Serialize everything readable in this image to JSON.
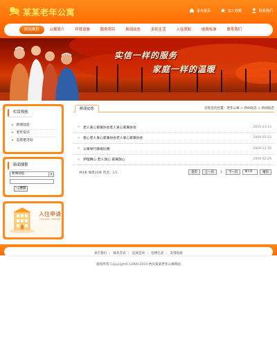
{
  "site": {
    "title": "某某老年公寓"
  },
  "top_links": [
    {
      "label": "设为首页",
      "icon": "home-icon"
    },
    {
      "label": "加入收藏",
      "icon": "star-icon"
    },
    {
      "label": "联系我们",
      "icon": "contact-icon"
    }
  ],
  "nav": [
    {
      "label": "网站首页",
      "active": true
    },
    {
      "label": "公寓简介"
    },
    {
      "label": "环境设施"
    },
    {
      "label": "服务项目"
    },
    {
      "label": "新闻动态"
    },
    {
      "label": "多彩生活"
    },
    {
      "label": "入住须知"
    },
    {
      "label": "收费标准"
    },
    {
      "label": "联系我们"
    }
  ],
  "banner": {
    "slogan_line1": "实信一样的服务",
    "slogan_line2": "家庭一样的温暖"
  },
  "sidebar": {
    "category_title": "栏目导航",
    "categories": [
      "新闻动态",
      "老年常识",
      "志愿者活动"
    ],
    "search_title": "新闻搜索",
    "search_select": "新闻动态",
    "search_button": "搜索"
  },
  "apply": {
    "title": "入住申请",
    "subtitle": "ONLINE ORDER"
  },
  "main": {
    "tab": "新闻动态",
    "breadcrumb": "您现在的位置：老年公寓 > 新闻动态 > 新闻动态",
    "news": [
      {
        "title": "老人爱心家属协会老人爱心家属协会",
        "date": "2010-03-13"
      },
      {
        "title": "极心老人爱心家属协会老人爱心家属协会",
        "date": "2009-05-10"
      },
      {
        "title": "公寓举行歌唱比赛",
        "date": "2009-12-30"
      },
      {
        "title": "护理精心 老人放心 家属放心",
        "date": "2009-12-29"
      }
    ],
    "pager": {
      "info": "共4条  每页20条  页次：1/1",
      "first": "首页",
      "prev": "上一页",
      "current": "1",
      "next": "下一页",
      "select": "第1页",
      "last": "尾页"
    }
  },
  "footer": {
    "links": [
      "关于我们",
      "联系方式",
      "在线咨询",
      "招聘信息",
      "友情链接"
    ],
    "copyright": "版权所有  Copyright(C)2009-2010 杭州某某老年公寓网站"
  },
  "colors": {
    "accent": "#ff6a00",
    "title_yellow": "#ffe566",
    "nav_text": "#c33000"
  }
}
